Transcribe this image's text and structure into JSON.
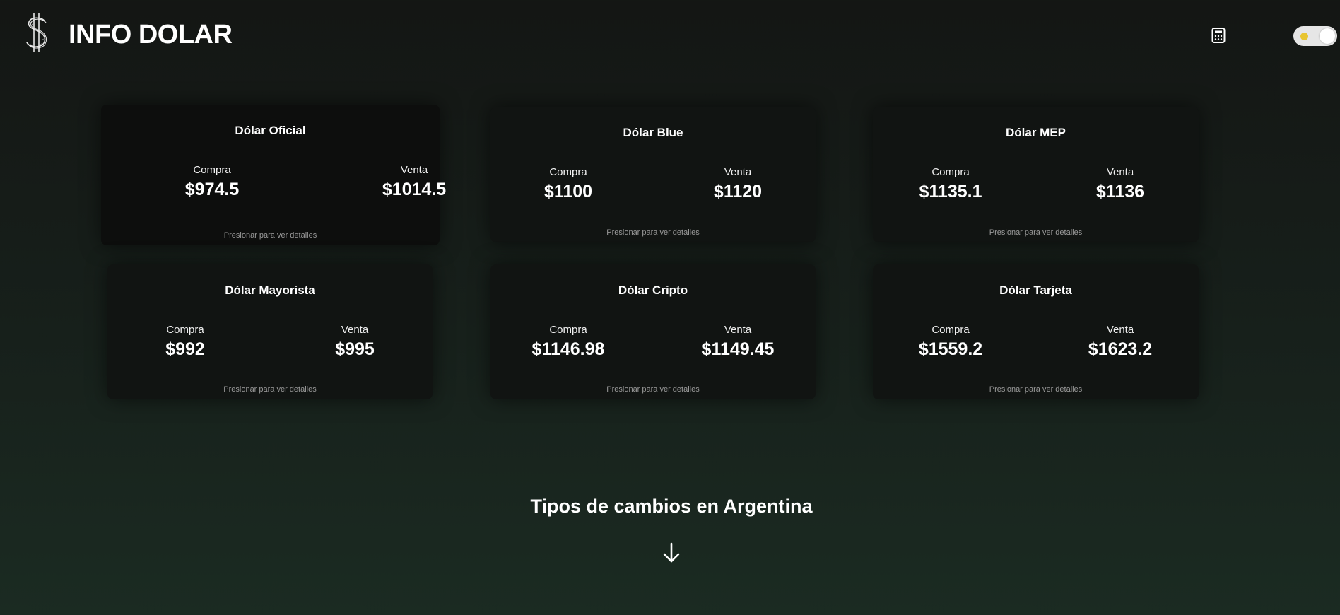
{
  "header": {
    "brand": "INFO DOLAR",
    "logo_icon": "dollar-sign-icon",
    "calculator_icon": "calculator-icon",
    "theme_toggle_dot_color": "#e8c530"
  },
  "cards": [
    {
      "title": "Dólar Oficial",
      "buy_label": "Compra",
      "buy": "$974.5",
      "sell_label": "Venta",
      "sell": "$1014.5",
      "hint": "Presionar para ver detalles"
    },
    {
      "title": "Dólar Blue",
      "buy_label": "Compra",
      "buy": "$1100",
      "sell_label": "Venta",
      "sell": "$1120",
      "hint": "Presionar para ver detalles"
    },
    {
      "title": "Dólar MEP",
      "buy_label": "Compra",
      "buy": "$1135.1",
      "sell_label": "Venta",
      "sell": "$1136",
      "hint": "Presionar para ver detalles"
    },
    {
      "title": "Dólar Mayorista",
      "buy_label": "Compra",
      "buy": "$992",
      "sell_label": "Venta",
      "sell": "$995",
      "hint": "Presionar para ver detalles"
    },
    {
      "title": "Dólar Cripto",
      "buy_label": "Compra",
      "buy": "$1146.98",
      "sell_label": "Venta",
      "sell": "$1149.45",
      "hint": "Presionar para ver detalles"
    },
    {
      "title": "Dólar Tarjeta",
      "buy_label": "Compra",
      "buy": "$1559.2",
      "sell_label": "Venta",
      "sell": "$1623.2",
      "hint": "Presionar para ver detalles"
    }
  ],
  "section": {
    "title": "Tipos de cambios en Argentina",
    "arrow_icon": "arrow-down-icon"
  }
}
